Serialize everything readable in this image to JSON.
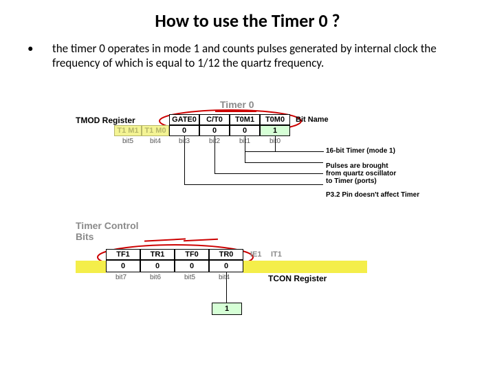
{
  "title": "How to use the Timer 0 ?",
  "bullet": "the timer 0 operates in mode 1 and counts pulses generated by internal clock the frequency of which is equal to 1/12 the quartz frequency.",
  "top": {
    "header": "Timer 0",
    "tmod": "TMOD Register",
    "t1m1": "T1 M1",
    "t1m0": "T1 M0",
    "cols": [
      "GATE0",
      "C/T0",
      "T0M1",
      "T0M0"
    ],
    "vals": [
      "0",
      "0",
      "0",
      "1"
    ],
    "bits": [
      "bit3",
      "bit2",
      "bit1",
      "bit0"
    ],
    "bit5": "bit5",
    "bit4": "bit4",
    "bitname": "Bit Name",
    "note1": "16-bit Timer (mode 1)",
    "note2a": "Pulses are brought",
    "note2b": "from quartz oscillator",
    "note2c": "to Timer (ports)",
    "note3": "P3.2 Pin doesn't affect Timer"
  },
  "bottom": {
    "header": "Timer Control\nBits",
    "cols": [
      "TF1",
      "TR1",
      "TF0",
      "TR0"
    ],
    "vals": [
      "0",
      "0",
      "0",
      "0"
    ],
    "bits": [
      "bit7",
      "bit6",
      "bit5",
      "bit4"
    ],
    "ie1": "IE1",
    "it1": "IT1",
    "tcon": "TCON Register",
    "one": "1"
  }
}
